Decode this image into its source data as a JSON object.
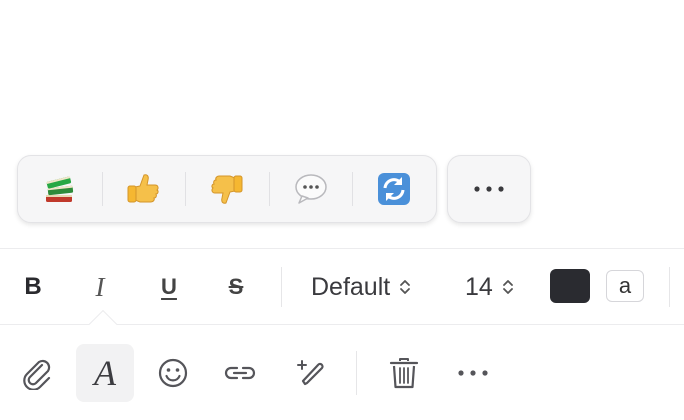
{
  "reactions": [
    {
      "icon": "books-emoji-icon"
    },
    {
      "icon": "thumbs-up-emoji-icon"
    },
    {
      "icon": "thumbs-down-emoji-icon"
    },
    {
      "icon": "speech-bubble-emoji-icon"
    },
    {
      "icon": "repeat-arrows-emoji-icon"
    }
  ],
  "more_reactions": {
    "icon": "more-horizontal-icon"
  },
  "format": {
    "bold": "B",
    "italic": "I",
    "underline": "U",
    "strikethrough": "S",
    "font": "Default",
    "size": "14",
    "text_color": "#2a2b30",
    "highlight_label": "a"
  },
  "bottom_toolbar": [
    {
      "icon": "paperclip-icon"
    },
    {
      "icon": "text-format-icon",
      "label": "A",
      "active": true
    },
    {
      "icon": "smiley-icon"
    },
    {
      "icon": "link-icon"
    },
    {
      "icon": "pen-sparkle-icon"
    },
    {
      "icon": "trash-icon"
    },
    {
      "icon": "more-horizontal-icon"
    }
  ]
}
